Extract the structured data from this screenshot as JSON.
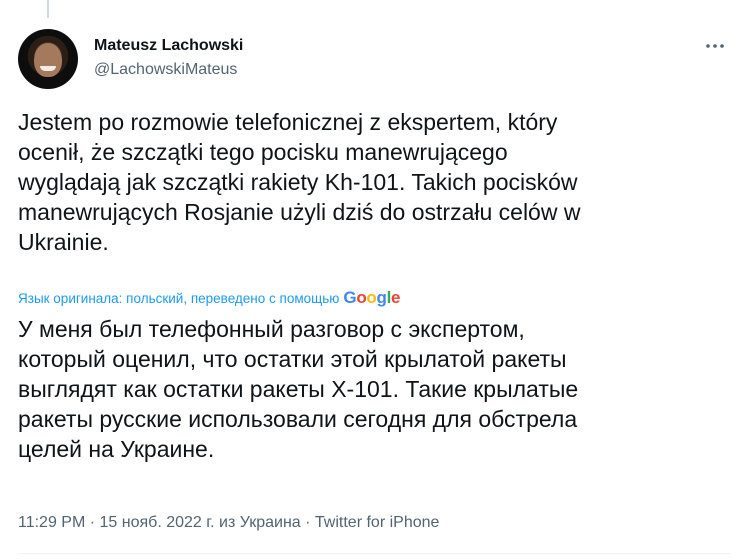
{
  "tweet": {
    "author": {
      "name": "Mateusz Lachowski",
      "handle": "@LachowskiMateus"
    },
    "more_icon": "more-horizontal-icon",
    "text": "Jestem po rozmowie telefonicznej z ekspertem, który\nocenił, że szczątki tego pocisku manewrującego\nwyglądają jak szczątki rakiety Kh-101. Takich pocisków\nmanewrujących Rosjanie użyli dziś do ostrzału celów w\nUkrainie.",
    "translation": {
      "label": "Язык оригинала: польский, переведено с помощью",
      "provider_letters": [
        "G",
        "o",
        "o",
        "g",
        "l",
        "e"
      ],
      "provider_colors": [
        "#4285F4",
        "#EA4335",
        "#FBBC05",
        "#4285F4",
        "#34A853",
        "#EA4335"
      ],
      "text": "У меня был телефонный разговор с экспертом,\nкоторый оценил, что остатки этой крылатой ракеты\nвыглядят как остатки ракеты Х-101. Такие крылатые\nракеты русские использовали сегодня для обстрела\nцелей на Украине."
    },
    "meta": {
      "time": "11:29 PM",
      "separator": "·",
      "date": "15 нояб. 2022 г. из Украина",
      "source": "Twitter for iPhone"
    },
    "colors": {
      "link": "#1d9bf0",
      "secondary_text": "#536471",
      "primary_text": "#0f1419"
    }
  }
}
